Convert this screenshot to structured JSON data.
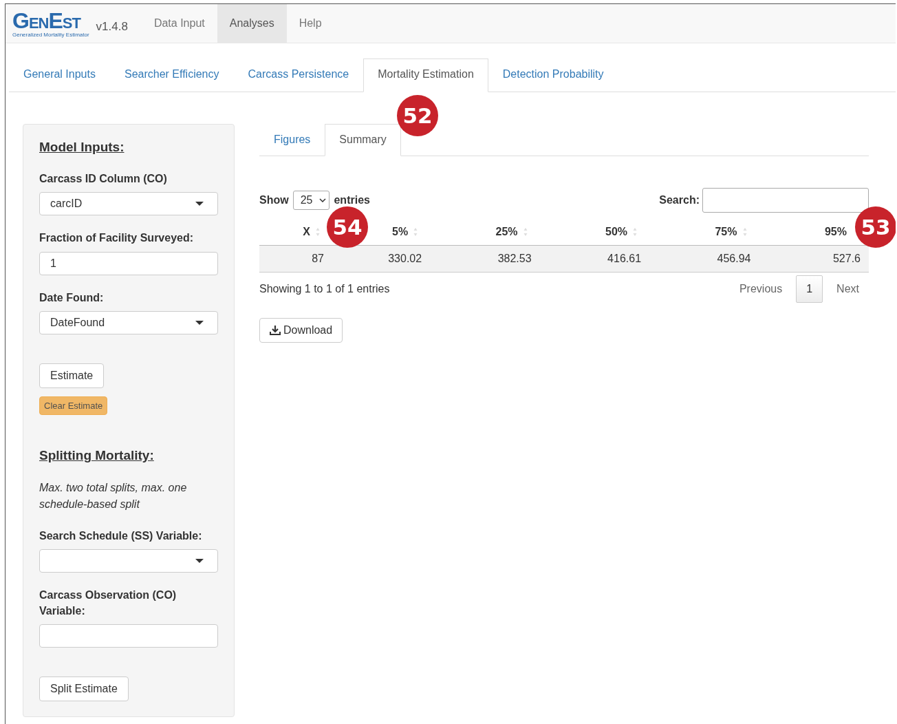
{
  "navbar": {
    "logo": "GenEst",
    "logo_subtitle": "Generalized Mortality Estimator",
    "version": "v1.4.8",
    "items": [
      {
        "label": "Data Input",
        "selected": false
      },
      {
        "label": "Analyses",
        "selected": true
      },
      {
        "label": "Help",
        "selected": false
      }
    ]
  },
  "tabs": [
    {
      "label": "General Inputs",
      "selected": false
    },
    {
      "label": "Searcher Efficiency",
      "selected": false
    },
    {
      "label": "Carcass Persistence",
      "selected": false
    },
    {
      "label": "Mortality Estimation",
      "selected": true
    },
    {
      "label": "Detection Probability",
      "selected": false
    }
  ],
  "sidebar": {
    "heading": "Model Inputs:",
    "fields": [
      {
        "label": "Carcass ID Column (CO)",
        "kind": "select",
        "value": "carcID"
      },
      {
        "label": "Fraction of Facility Surveyed:",
        "kind": "text",
        "value": "1"
      },
      {
        "label": "Date Found:",
        "kind": "select",
        "value": "DateFound"
      }
    ],
    "estimate_button": "Estimate",
    "clear_button": "Clear Estimate",
    "split_heading": "Splitting Mortality:",
    "split_note": "Max. two total splits, max. one schedule-based split",
    "split_fields": [
      {
        "label": "Search Schedule (SS) Variable:",
        "kind": "select"
      },
      {
        "label": "Carcass Observation (CO) Variable:",
        "kind": "text"
      }
    ],
    "split_button": "Split Estimate"
  },
  "subtabs": [
    {
      "label": "Figures",
      "selected": false
    },
    {
      "label": "Summary",
      "selected": true
    }
  ],
  "table": {
    "show_label": "Show",
    "page_size": "25",
    "entries_label": "entries",
    "search_label": "Search:",
    "columns": [
      "X",
      "5%",
      "25%",
      "50%",
      "75%",
      "95%"
    ],
    "rows": [
      [
        "87",
        "330.02",
        "382.53",
        "416.61",
        "456.94",
        "527.6"
      ]
    ],
    "info": "Showing 1 to 1 of 1 entries",
    "previous": "Previous",
    "page": "1",
    "next": "Next"
  },
  "download_button": "Download",
  "callouts": [
    "52",
    "54",
    "53"
  ]
}
